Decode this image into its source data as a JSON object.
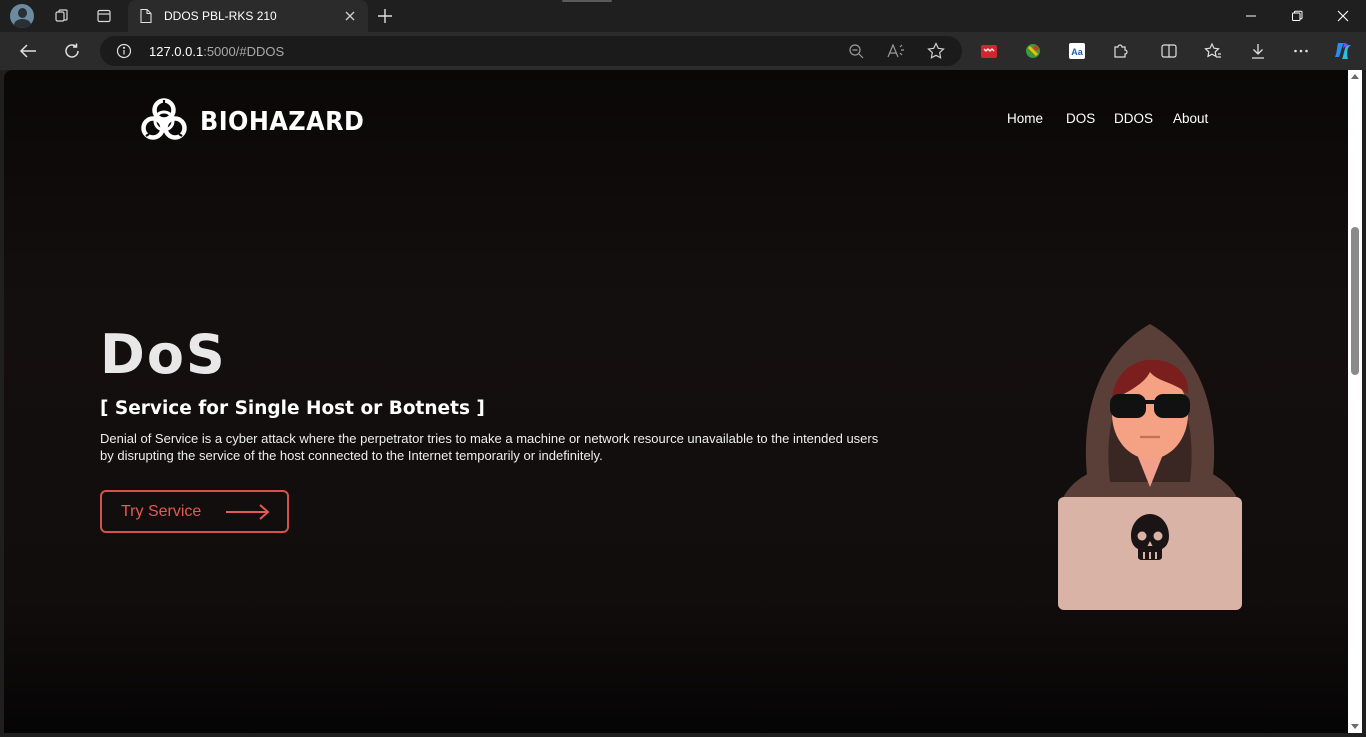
{
  "browser": {
    "tab_title": "DDOS PBL-RKS 210",
    "url_host": "127.0.0.1",
    "url_rest": ":5000/#DDOS",
    "accent_color": "#1b1b1b"
  },
  "site": {
    "logo_text": "BIOHAZARD",
    "nav": [
      "Home",
      "DOS",
      "DDOS",
      "About"
    ]
  },
  "hero": {
    "title": "DoS",
    "subtitle": "[ Service for Single Host or Botnets ]",
    "description": "Denial of Service is a cyber attack where the perpetrator tries to make a machine or network resource unavailable to the intended users by disrupting the service of the host connected to the Internet temporarily or indefinitely.",
    "cta_label": "Try Service",
    "cta_color": "#d4514c"
  },
  "icons": {
    "logo": "biohazard-icon",
    "illustration": "hooded-hacker-with-skull-laptop"
  }
}
